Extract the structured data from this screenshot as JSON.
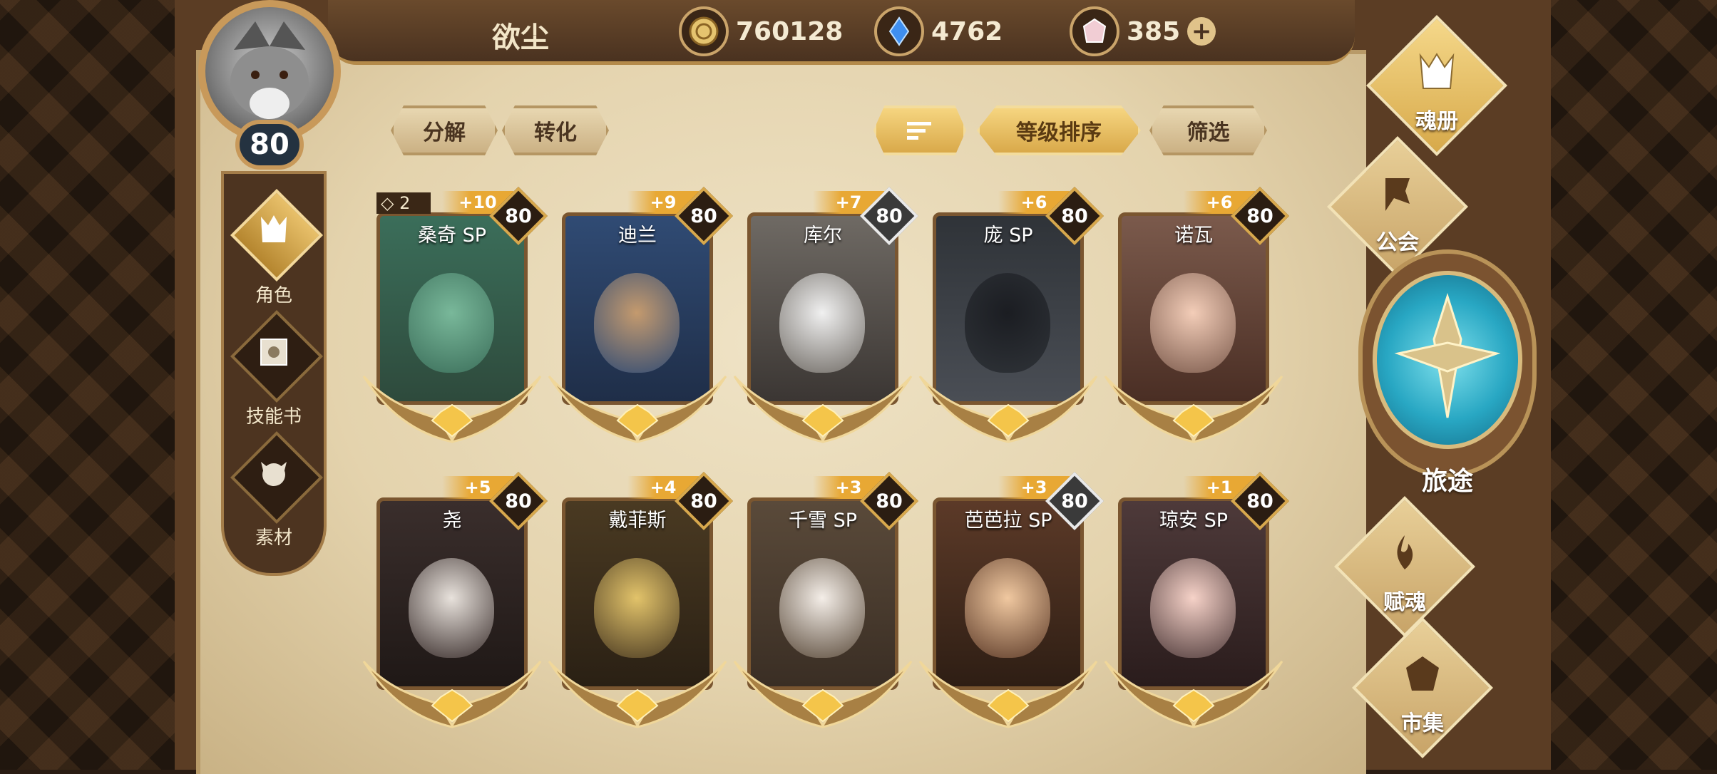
{
  "player": {
    "name": "欲尘",
    "level": "80"
  },
  "resources": [
    {
      "name": "gold-coin-icon",
      "value": "760128"
    },
    {
      "name": "blue-crystal-icon",
      "value": "4762"
    },
    {
      "name": "pink-gem-icon",
      "value": "385",
      "plus": "+"
    }
  ],
  "left_nav": [
    {
      "label": "角色",
      "icon": "character-helm-icon",
      "active": true
    },
    {
      "label": "技能书",
      "icon": "skill-book-icon",
      "active": false
    },
    {
      "label": "素材",
      "icon": "material-beast-icon",
      "active": false
    }
  ],
  "actions": {
    "decompose": "分解",
    "convert": "转化",
    "sort_level": "等级排序",
    "filter": "筛选"
  },
  "cards": [
    {
      "name": "桑奇 SP",
      "plus": "+10",
      "level": "80",
      "rank": "2",
      "gold": true,
      "palette": [
        "#3b6e5a",
        "#79b89a",
        "#2e4a3c"
      ]
    },
    {
      "name": "迪兰",
      "plus": "+9",
      "level": "80",
      "gold": true,
      "palette": [
        "#304b74",
        "#c49a6e",
        "#1f2e48"
      ]
    },
    {
      "name": "库尔",
      "plus": "+7",
      "level": "80",
      "gold": false,
      "palette": [
        "#6f6a64",
        "#f0f0f0",
        "#3b3633"
      ]
    },
    {
      "name": "庞 SP",
      "plus": "+6",
      "level": "80",
      "gold": true,
      "palette": [
        "#2f3338",
        "#1b1d22",
        "#4a4e55"
      ]
    },
    {
      "name": "诺瓦",
      "plus": "+6",
      "level": "80",
      "gold": true,
      "palette": [
        "#7b5a4c",
        "#f3cdb8",
        "#4a2e24"
      ]
    },
    {
      "name": "尧",
      "plus": "+5",
      "level": "80",
      "gold": true,
      "palette": [
        "#3a2e2c",
        "#e8e2dc",
        "#1f1816"
      ]
    },
    {
      "name": "戴菲斯",
      "plus": "+4",
      "level": "80",
      "gold": true,
      "palette": [
        "#4a3a22",
        "#e2c36a",
        "#2a2014"
      ]
    },
    {
      "name": "千雪 SP",
      "plus": "+3",
      "level": "80",
      "gold": true,
      "palette": [
        "#5a4a3a",
        "#f4eee8",
        "#3a2e24"
      ]
    },
    {
      "name": "芭芭拉 SP",
      "plus": "+3",
      "level": "80",
      "gold": false,
      "palette": [
        "#5c3a28",
        "#f0c8a0",
        "#2e1e14"
      ]
    },
    {
      "name": "琼安 SP",
      "plus": "+1",
      "level": "80",
      "gold": true,
      "palette": [
        "#4e3a3a",
        "#f6d2c8",
        "#2a1c1c"
      ]
    }
  ],
  "right_nav": [
    {
      "label": "魂册",
      "icon": "soul-book-icon",
      "active": true
    },
    {
      "label": "公会",
      "icon": "guild-banner-icon",
      "active": false
    },
    {
      "label": "旅途",
      "icon": "journey-emblem-icon",
      "active": false
    },
    {
      "label": "赋魂",
      "icon": "soul-flame-icon",
      "active": false
    },
    {
      "label": "市集",
      "icon": "market-gem-icon",
      "active": false
    }
  ]
}
